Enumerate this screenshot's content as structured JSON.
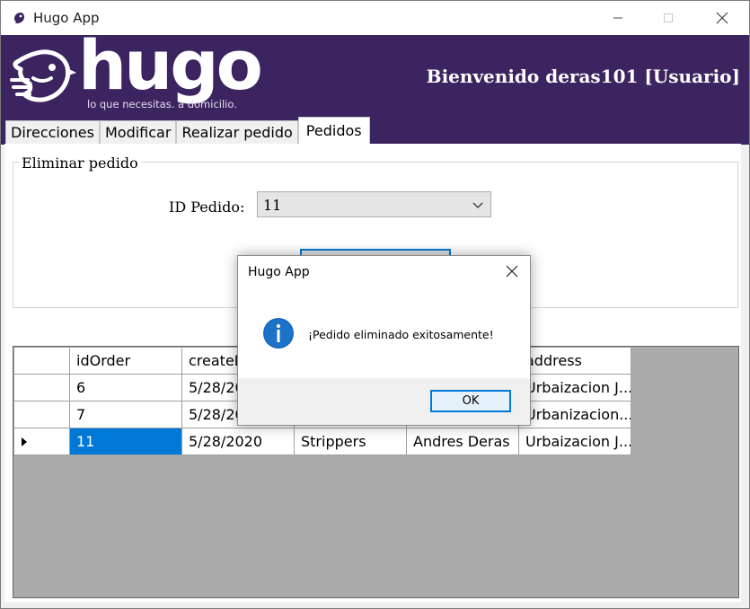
{
  "window": {
    "title": "Hugo App",
    "controls": [
      "minimize-icon",
      "maximize-icon",
      "close-icon"
    ]
  },
  "header": {
    "logo_text": "hugo",
    "tagline": "lo que necesitas. a domicilio.",
    "welcome": "Bienvenido deras101 [Usuario]",
    "colors": {
      "background": "#3b2460",
      "text": "#ffffff"
    }
  },
  "tabs": [
    {
      "label": "Direcciones",
      "active": false
    },
    {
      "label": "Modificar",
      "active": false
    },
    {
      "label": "Realizar pedido",
      "active": false
    },
    {
      "label": "Pedidos",
      "active": true
    }
  ],
  "delete_group": {
    "legend": "Eliminar pedido",
    "field_label": "ID Pedido:",
    "selected_id": "11"
  },
  "grid": {
    "columns": [
      "idOrder",
      "createD",
      "",
      "",
      "address"
    ],
    "rows": [
      {
        "current": false,
        "cells": [
          "6",
          "5/28/20",
          "",
          "",
          "Urbaizacion J..."
        ]
      },
      {
        "current": false,
        "cells": [
          "7",
          "5/28/20",
          "",
          "",
          "Urbanizacion..."
        ]
      },
      {
        "current": true,
        "cells": [
          "11",
          "5/28/2020",
          "Strippers",
          "Andres Deras",
          "Urbaizacion J..."
        ]
      }
    ]
  },
  "dialog": {
    "title": "Hugo App",
    "message": "¡Pedido eliminado exitosamente!",
    "ok_label": "OK",
    "icon": "info-icon"
  },
  "accent_color": "#0078d7"
}
